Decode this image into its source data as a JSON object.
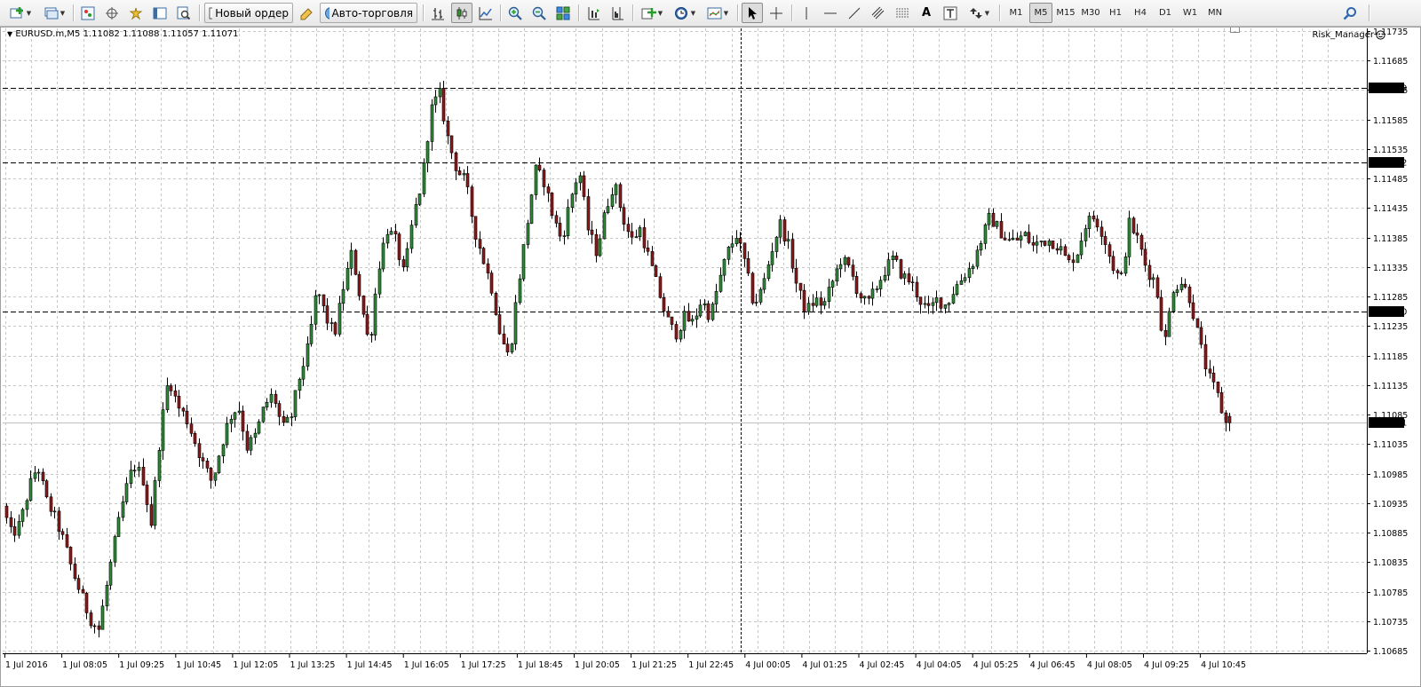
{
  "toolbar": {
    "new_order_label": "Новый ордер",
    "auto_trading_label": "Авто-торговля",
    "timeframes": [
      "M1",
      "M5",
      "M15",
      "M30",
      "H1",
      "H4",
      "D1",
      "W1",
      "MN"
    ],
    "active_timeframe": "M5"
  },
  "chart": {
    "symbol_info": "EURUSD.m,M5  1.11082 1.11088 1.11057 1.11071",
    "expert_label": "Risk_Manager",
    "current_price_label": "1.11071",
    "hline_labels": [
      "1.11639",
      "1.11512",
      "1.11260"
    ],
    "colors": {
      "bull_body": "#2e8b3a",
      "bear_body": "#8b1a1a",
      "wick": "#000000",
      "grid": "#c6c6c6",
      "background": "#ffffff"
    }
  },
  "chart_data": {
    "type": "candlestick",
    "symbol": "EURUSD.m",
    "timeframe": "M5",
    "y_ticks": [
      "1.11735",
      "1.11685",
      "1.11635",
      "1.11585",
      "1.11535",
      "1.11485",
      "1.11435",
      "1.11385",
      "1.11335",
      "1.11285",
      "1.11235",
      "1.11185",
      "1.11135",
      "1.11085",
      "1.11035",
      "1.10985",
      "1.10935",
      "1.10885",
      "1.10835",
      "1.10785",
      "1.10735",
      "1.10685"
    ],
    "ylim": [
      1.1068,
      1.1174
    ],
    "x_ticks": [
      "1 Jul 2016",
      "1 Jul 08:05",
      "1 Jul 09:25",
      "1 Jul 10:45",
      "1 Jul 12:05",
      "1 Jul 13:25",
      "1 Jul 14:45",
      "1 Jul 16:05",
      "1 Jul 17:25",
      "1 Jul 18:45",
      "1 Jul 20:05",
      "1 Jul 21:25",
      "1 Jul 22:45",
      "4 Jul 00:05",
      "4 Jul 01:25",
      "4 Jul 02:45",
      "4 Jul 04:05",
      "4 Jul 05:25",
      "4 Jul 06:45",
      "4 Jul 08:05",
      "4 Jul 09:25",
      "4 Jul 10:45"
    ],
    "horizontal_lines": [
      1.11639,
      1.11512,
      1.1126
    ],
    "current_price": 1.11071,
    "last_bar": {
      "open": 1.11082,
      "high": 1.11088,
      "low": 1.11057,
      "close": 1.11071
    },
    "path": [
      1.1093,
      1.1088,
      1.109,
      1.1096,
      1.11,
      1.1094,
      1.1091,
      1.1087,
      1.1082,
      1.1078,
      1.1074,
      1.1072,
      1.108,
      1.1088,
      1.1095,
      1.11,
      1.1098,
      1.109,
      1.1105,
      1.1115,
      1.111,
      1.1108,
      1.1104,
      1.11,
      1.1097,
      1.1103,
      1.1108,
      1.111,
      1.1103,
      1.1105,
      1.111,
      1.1112,
      1.1106,
      1.1108,
      1.1115,
      1.112,
      1.113,
      1.1125,
      1.1122,
      1.113,
      1.1136,
      1.1128,
      1.112,
      1.1133,
      1.114,
      1.1138,
      1.1132,
      1.1142,
      1.1148,
      1.116,
      1.1163,
      1.1155,
      1.115,
      1.1148,
      1.114,
      1.1135,
      1.113,
      1.1122,
      1.1118,
      1.113,
      1.114,
      1.115,
      1.1148,
      1.1142,
      1.1138,
      1.1145,
      1.115,
      1.114,
      1.1136,
      1.1143,
      1.1148,
      1.1142,
      1.1138,
      1.114,
      1.1135,
      1.113,
      1.1125,
      1.1122,
      1.1125,
      1.1124,
      1.1128,
      1.1125,
      1.1131,
      1.1136,
      1.1139,
      1.1134,
      1.1127,
      1.113,
      1.1136,
      1.1141,
      1.1137,
      1.113,
      1.1126,
      1.1128,
      1.1127,
      1.1131,
      1.1135,
      1.1133,
      1.1129,
      1.1127,
      1.113,
      1.1133,
      1.1135,
      1.1132,
      1.1131,
      1.1128,
      1.1126,
      1.1128,
      1.1127,
      1.113,
      1.1132,
      1.1134,
      1.1138,
      1.1142,
      1.114,
      1.1138,
      1.1138,
      1.1139,
      1.1137,
      1.1138,
      1.1138,
      1.1137,
      1.1134,
      1.1136,
      1.1141,
      1.1142,
      1.1139,
      1.1134,
      1.1131,
      1.1141,
      1.1138,
      1.1133,
      1.1131,
      1.112,
      1.113,
      1.1131,
      1.1128,
      1.1121,
      1.1115,
      1.1112,
      1.1107
    ]
  }
}
